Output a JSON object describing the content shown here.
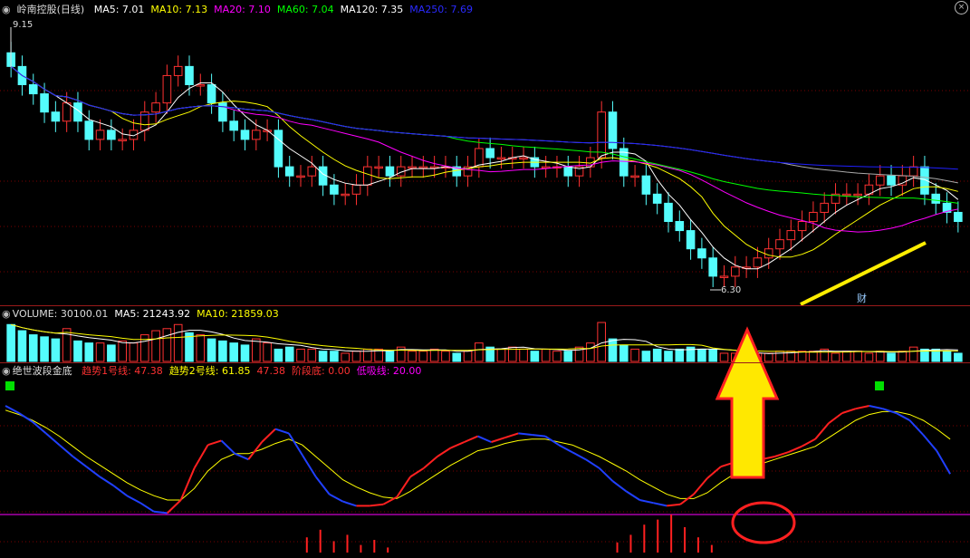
{
  "colors": {
    "bg": "#000000",
    "up": "#ff3232",
    "down": "#54fcfc",
    "ma5": "#ffffff",
    "ma10": "#ffff00",
    "ma20": "#ff00ff",
    "ma60": "#00ff00",
    "ma120": "#aaaaaa",
    "ma250": "#2020ff",
    "grid": "#7a0000"
  },
  "price_panel": {
    "title": "岭南控股(日线)",
    "title_icon": "collapse-circle-icon",
    "ma": [
      {
        "label": "MA5: 7.01",
        "color": "#ffffff"
      },
      {
        "label": "MA10: 7.13",
        "color": "#ffff00"
      },
      {
        "label": "MA20: 7.10",
        "color": "#ff00ff"
      },
      {
        "label": "MA60: 7.04",
        "color": "#00ff00"
      },
      {
        "label": "MA120: 7.35",
        "color": "#ffffff"
      },
      {
        "label": "MA250: 7.69",
        "color": "#2a2aff"
      }
    ],
    "high_label": "9.15",
    "low_label": "6.30",
    "annotation": "财"
  },
  "volume_panel": {
    "title": "VOLUME: 30100.01",
    "ma5": "MA5: 21243.92",
    "ma10": "MA10: 21859.03"
  },
  "indicator_panel": {
    "title": "绝世波段金底",
    "items": [
      {
        "label": "趋势1号线: 47.38",
        "color": "#ff3232"
      },
      {
        "label": "趋势2号线: 61.85",
        "color": "#ffff00"
      },
      {
        "label": "47.38",
        "color": "#ff3232"
      },
      {
        "label": "阶段底: 0.00",
        "color": "#ff3232"
      },
      {
        "label": "低吸线: 20.00",
        "color": "#ff00ff"
      }
    ]
  },
  "chart_data": {
    "type": "candlestick",
    "count": 86,
    "close_series": [
      8.7,
      8.5,
      8.4,
      8.2,
      8.1,
      8.3,
      8.1,
      7.9,
      8.0,
      7.9,
      7.9,
      8.0,
      8.2,
      8.3,
      8.6,
      8.7,
      8.5,
      8.5,
      8.3,
      8.1,
      8.0,
      7.9,
      8.0,
      8.0,
      7.6,
      7.5,
      7.5,
      7.6,
      7.4,
      7.3,
      7.3,
      7.4,
      7.6,
      7.6,
      7.5,
      7.6,
      7.6,
      7.6,
      7.6,
      7.6,
      7.5,
      7.6,
      7.8,
      7.7,
      7.7,
      7.7,
      7.7,
      7.6,
      7.6,
      7.6,
      7.5,
      7.6,
      7.7,
      8.2,
      7.8,
      7.5,
      7.5,
      7.3,
      7.2,
      7.0,
      6.9,
      6.7,
      6.6,
      6.4,
      6.4,
      6.5,
      6.5,
      6.6,
      6.7,
      6.8,
      6.9,
      7.0,
      7.1,
      7.2,
      7.3,
      7.3,
      7.3,
      7.4,
      7.5,
      7.4,
      7.5,
      7.6,
      7.3,
      7.2,
      7.1,
      7.0
    ],
    "price_high": 9.15,
    "price_low": 6.3,
    "volume": [
      18,
      15,
      13,
      12,
      11,
      16,
      10,
      9,
      9,
      8,
      10,
      9,
      13,
      15,
      16,
      18,
      14,
      13,
      11,
      10,
      9,
      8,
      11,
      9,
      6,
      7,
      6,
      6,
      5,
      5,
      4,
      5,
      6,
      6,
      5,
      7,
      5,
      5,
      6,
      5,
      4,
      5,
      9,
      7,
      6,
      7,
      6,
      5,
      6,
      5,
      5,
      7,
      9,
      19,
      11,
      8,
      6,
      5,
      6,
      5,
      6,
      7,
      6,
      6,
      4,
      4,
      3,
      4,
      4,
      5,
      5,
      5,
      5,
      6,
      4,
      5,
      5,
      4,
      5,
      4,
      5,
      7,
      6,
      6,
      5,
      4
    ],
    "indicator": {
      "trend1": [
        95,
        90,
        84,
        76,
        68,
        60,
        53,
        46,
        40,
        33,
        28,
        22,
        21,
        30,
        52,
        68,
        71,
        62,
        58,
        70,
        79,
        76,
        61,
        46,
        34,
        29,
        26,
        26,
        27,
        32,
        46,
        52,
        60,
        66,
        70,
        74,
        70,
        73,
        76,
        75,
        74,
        68,
        63,
        58,
        52,
        43,
        36,
        30,
        28,
        26,
        27,
        34,
        45,
        53,
        56,
        54,
        58,
        60,
        63,
        67,
        72,
        83,
        90,
        93,
        95,
        93,
        90,
        85,
        75,
        64,
        48
      ],
      "trend2": [
        92,
        89,
        85,
        80,
        74,
        67,
        60,
        54,
        48,
        42,
        37,
        33,
        30,
        30,
        38,
        50,
        58,
        62,
        62,
        65,
        69,
        72,
        68,
        60,
        52,
        44,
        39,
        35,
        32,
        31,
        36,
        42,
        48,
        54,
        59,
        64,
        66,
        69,
        71,
        72,
        72,
        70,
        68,
        64,
        60,
        55,
        50,
        44,
        39,
        34,
        31,
        31,
        35,
        42,
        48,
        52,
        55,
        58,
        61,
        64,
        67,
        73,
        79,
        85,
        89,
        91,
        91,
        89,
        85,
        79,
        72
      ],
      "low_line": 20,
      "bottom_bars": [
        0,
        0,
        0,
        0,
        0,
        0,
        0,
        0,
        0,
        0,
        0,
        0,
        0,
        0,
        0,
        0,
        0,
        0,
        0,
        0,
        0,
        0,
        0,
        0,
        0,
        0,
        0,
        0,
        0,
        0,
        0,
        0,
        0,
        0,
        0,
        0,
        0,
        0,
        0,
        0,
        0,
        0,
        0,
        0,
        0,
        0,
        0,
        0,
        0,
        0,
        0,
        0,
        0,
        0,
        0,
        0,
        0,
        0,
        0,
        0,
        0,
        0,
        0,
        0,
        0,
        0,
        0,
        0,
        0,
        0,
        0
      ]
    }
  }
}
